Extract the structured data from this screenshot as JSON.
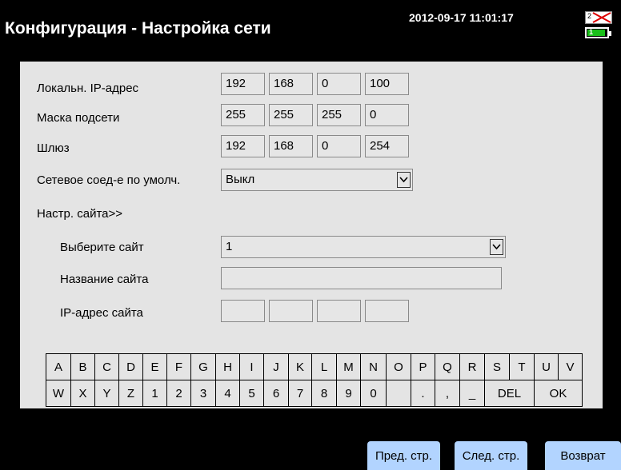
{
  "header": {
    "title": "Конфигурация - Настройка сети",
    "datetime": "2012-09-17 11:01:17",
    "net_number": "2",
    "battery_number": "1"
  },
  "form": {
    "local_ip": {
      "label": "Локальн. IP-адрес",
      "octets": [
        "192",
        "168",
        "0",
        "100"
      ]
    },
    "subnet_mask": {
      "label": "Маска подсети",
      "octets": [
        "255",
        "255",
        "255",
        "0"
      ]
    },
    "gateway": {
      "label": "Шлюз",
      "octets": [
        "192",
        "168",
        "0",
        "254"
      ]
    },
    "default_connection": {
      "label": "Сетевое соед-е по умолч.",
      "value": "Выкл"
    },
    "site_settings_label": "Настр. сайта>>",
    "select_site": {
      "label": "Выберите сайт",
      "value": "1"
    },
    "site_name": {
      "label": "Название сайта",
      "value": ""
    },
    "site_ip": {
      "label": "IP-адрес сайта",
      "octets": [
        "",
        "",
        "",
        ""
      ]
    }
  },
  "keyboard": {
    "row1": [
      "A",
      "B",
      "C",
      "D",
      "E",
      "F",
      "G",
      "H",
      "I",
      "J",
      "K",
      "L",
      "M",
      "N",
      "O",
      "P",
      "Q",
      "R",
      "S",
      "T",
      "U",
      "V"
    ],
    "row2": [
      "W",
      "X",
      "Y",
      "Z",
      "1",
      "2",
      "3",
      "4",
      "5",
      "6",
      "7",
      "8",
      "9",
      "0",
      "",
      ".",
      ",",
      "_",
      "DEL",
      "OK"
    ]
  },
  "footer": {
    "prev_label": "Пред. стр.",
    "next_label": "След. стр.",
    "back_label": "Возврат"
  }
}
